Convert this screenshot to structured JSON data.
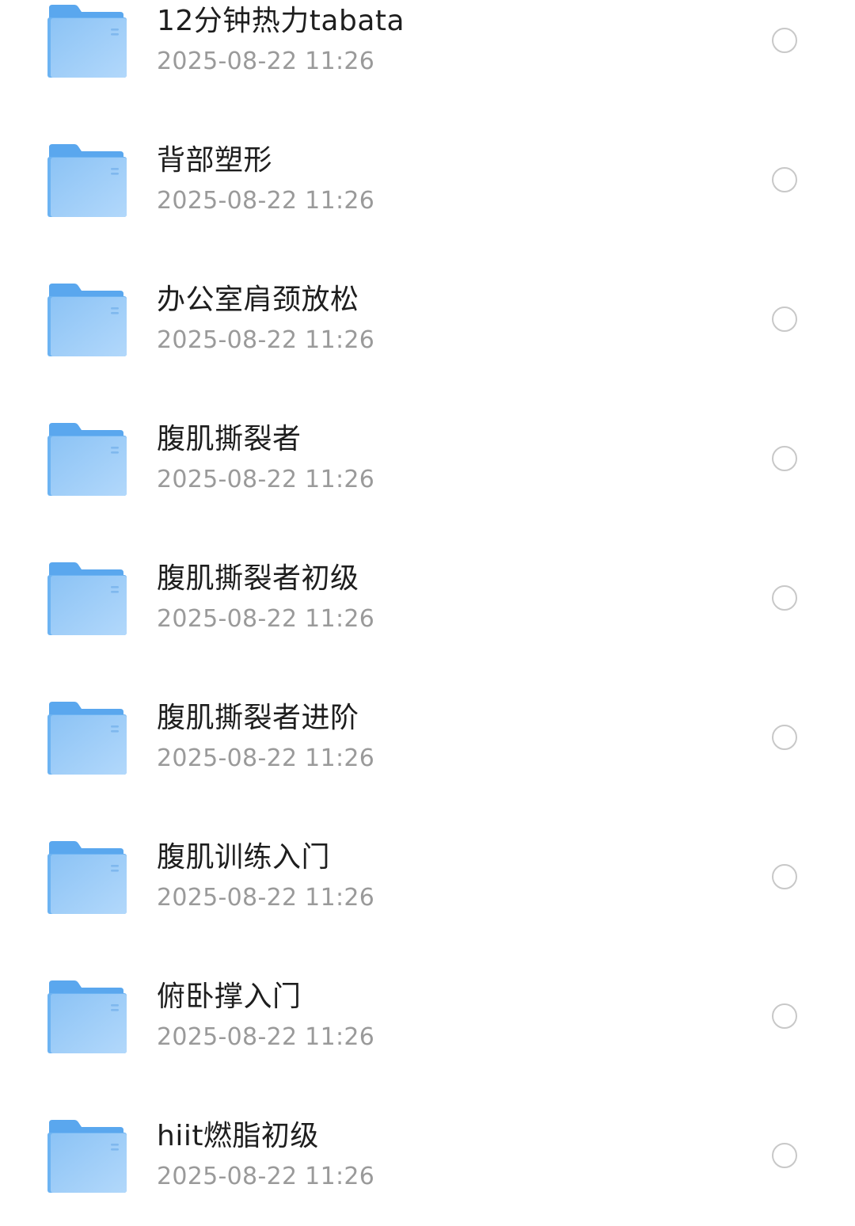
{
  "colors": {
    "folder_back": "#5aa7ee",
    "folder_front_top": "#8cc3f5",
    "folder_front_bottom": "#b2d8fb",
    "name_text": "#1e1e1e",
    "date_text": "#9a9a9a",
    "radio_border": "#c8c8c8"
  },
  "folders": [
    {
      "name": "12分钟热力tabata",
      "date": "2025-08-22 11:26",
      "icon": "folder-icon",
      "selected": false
    },
    {
      "name": "背部塑形",
      "date": "2025-08-22 11:26",
      "icon": "folder-icon",
      "selected": false
    },
    {
      "name": "办公室肩颈放松",
      "date": "2025-08-22 11:26",
      "icon": "folder-icon",
      "selected": false
    },
    {
      "name": "腹肌撕裂者",
      "date": "2025-08-22 11:26",
      "icon": "folder-icon",
      "selected": false
    },
    {
      "name": "腹肌撕裂者初级",
      "date": "2025-08-22 11:26",
      "icon": "folder-icon",
      "selected": false
    },
    {
      "name": "腹肌撕裂者进阶",
      "date": "2025-08-22 11:26",
      "icon": "folder-icon",
      "selected": false
    },
    {
      "name": "腹肌训练入门",
      "date": "2025-08-22 11:26",
      "icon": "folder-icon",
      "selected": false
    },
    {
      "name": "俯卧撑入门",
      "date": "2025-08-22 11:26",
      "icon": "folder-icon",
      "selected": false
    },
    {
      "name": "hiit燃脂初级",
      "date": "2025-08-22 11:26",
      "icon": "folder-icon",
      "selected": false
    }
  ]
}
